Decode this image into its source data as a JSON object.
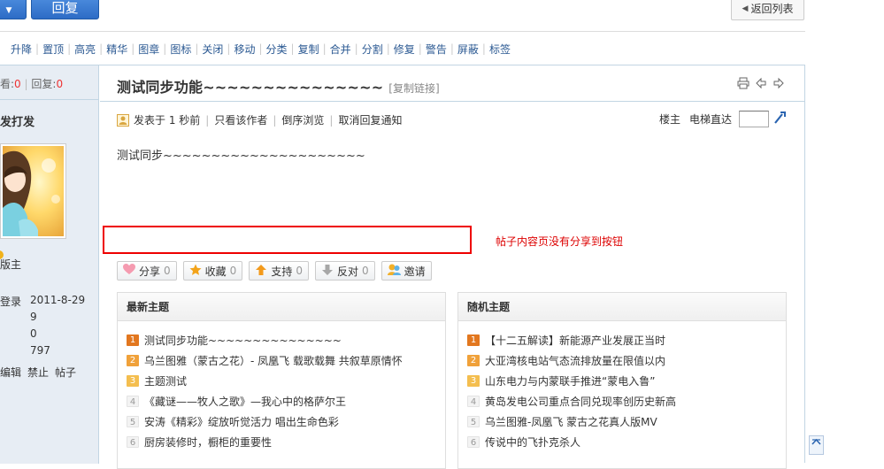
{
  "top": {
    "reply_label": "回复",
    "back_label": "返回列表"
  },
  "modbar": {
    "items": [
      "升降",
      "置顶",
      "高亮",
      "精华",
      "图章",
      "图标",
      "关闭",
      "移动",
      "分类",
      "复制",
      "合并",
      "分割",
      "修复",
      "警告",
      "屏蔽",
      "标签"
    ]
  },
  "stats": {
    "views_label": "看:",
    "views_value": "0",
    "replies_label": "回复:",
    "replies_value": "0"
  },
  "author": {
    "name": "发打发",
    "role": "版主",
    "fields": [
      {
        "label": "登录",
        "value": "2011-8-29"
      },
      {
        "label": "",
        "value": "9"
      },
      {
        "label": "",
        "value": "0"
      },
      {
        "label": "",
        "value": "797"
      }
    ],
    "actions": [
      "编辑",
      "禁止",
      "帖子"
    ]
  },
  "post": {
    "title": "测试同步功能~~~~~~~~~~~~~~~",
    "copy_link": "[复制链接]",
    "meta_posted": "发表于 1 秒前",
    "meta_links": [
      "只看该作者",
      "倒序浏览",
      "取消回复通知"
    ],
    "floor_label": "楼主",
    "jump_label": "电梯直达",
    "body": "测试同步~~~~~~~~~~~~~~~~~~~~~",
    "annotation": "帖子内容页没有分享到按钮"
  },
  "actions": [
    {
      "label": "分享",
      "count": "0",
      "icon": "heart-icon"
    },
    {
      "label": "收藏",
      "count": "0",
      "icon": "star-icon"
    },
    {
      "label": "支持",
      "count": "0",
      "icon": "arrow-up-icon"
    },
    {
      "label": "反对",
      "count": "0",
      "icon": "arrow-down-icon"
    },
    {
      "label": "邀请",
      "count": "",
      "icon": "invite-icon"
    }
  ],
  "latest": {
    "title": "最新主题",
    "items": [
      {
        "n": "1",
        "text": "测试同步功能~~~~~~~~~~~~~~~"
      },
      {
        "n": "2",
        "text": "乌兰图雅（蒙古之花）- 凤凰飞 载歌载舞 共叙草原情怀"
      },
      {
        "n": "3",
        "text": "主题测试"
      },
      {
        "n": "4",
        "text": "《藏谜——牧人之歌》—我心中的格萨尔王"
      },
      {
        "n": "5",
        "text": "安涛《精彩》绽放听觉活力 唱出生命色彩"
      },
      {
        "n": "6",
        "text": "厨房装修时，橱柜的重要性"
      }
    ]
  },
  "random": {
    "title": "随机主题",
    "items": [
      {
        "n": "1",
        "text": "【十二五解读】新能源产业发展正当时"
      },
      {
        "n": "2",
        "text": "大亚湾核电站气态流排放量在限值以内"
      },
      {
        "n": "3",
        "text": "山东电力与内蒙联手推进“蒙电入鲁”"
      },
      {
        "n": "4",
        "text": "黄岛发电公司重点合同兑现率创历史新高"
      },
      {
        "n": "5",
        "text": "乌兰图雅-凤凰飞 蒙古之花真人版MV"
      },
      {
        "n": "6",
        "text": "传说中的飞扑克杀人"
      }
    ]
  }
}
